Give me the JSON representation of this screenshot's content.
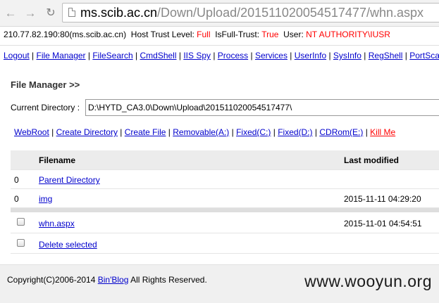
{
  "browser": {
    "url_host": "ms.scib.ac.cn",
    "url_path": "/Down/Upload/201511020054517477/whn.aspx"
  },
  "info": {
    "host": "210.77.82.190:80(ms.scib.ac.cn)",
    "trust_label": "Host Trust Level:",
    "trust_value": "Full",
    "fulltrust_label": "IsFull-Trust:",
    "fulltrust_value": "True",
    "user_label": "User:",
    "user_value": "NT AUTHORITY\\IUSR"
  },
  "menu": [
    "Logout",
    "File Manager",
    "FileSearch",
    "CmdShell",
    "IIS Spy",
    "Process",
    "Services",
    "UserInfo",
    "SysInfo",
    "RegShell",
    "PortScan"
  ],
  "page": {
    "title": "File Manager >>",
    "current_dir_label": "Current Directory :",
    "current_dir_value": "D:\\HYTD_CA3.0\\Down\\Upload\\201511020054517477\\"
  },
  "actions": [
    "WebRoot",
    "Create Directory",
    "Create File",
    "Removable(A:)",
    "Fixed(C:)",
    "Fixed(D:)",
    "CDRom(E:)",
    "Kill Me"
  ],
  "table": {
    "headers": {
      "name": "Filename",
      "modified": "Last modified"
    },
    "parent": {
      "index": "0",
      "name": "Parent Directory"
    },
    "dirs": [
      {
        "index": "0",
        "name": "img",
        "modified": "2015-11-11 04:29:20"
      }
    ],
    "files": [
      {
        "name": "whn.aspx",
        "modified": "2015-11-01 04:54:51"
      }
    ],
    "delete_label": "Delete selected"
  },
  "footer": {
    "copyright_pre": "Copyright(C)2006-2014",
    "copyright_link": "Bin'Blog",
    "copyright_post": "All Rights Reserved.",
    "watermark": "www.wooyun.org"
  },
  "colors": {
    "link": "#0000cc",
    "alert": "#ff0000"
  }
}
